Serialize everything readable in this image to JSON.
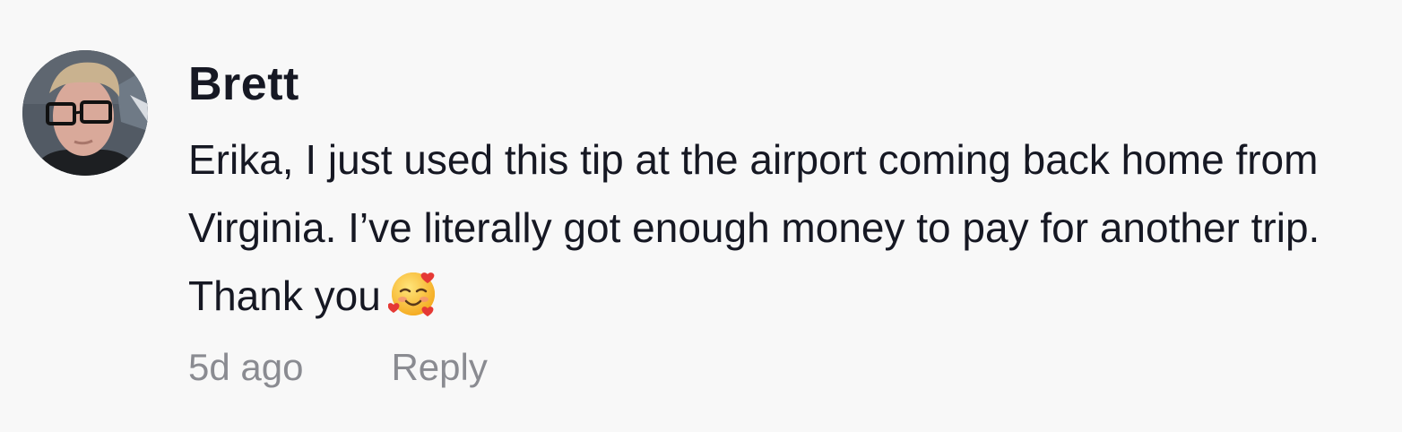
{
  "comment": {
    "username": "Brett",
    "avatar_icon": "user-avatar-photo",
    "text": "Erika, I just used this tip at the airport coming back home from Virginia. I’ve literally got enough money to pay for another trip. Thank you",
    "emoji_icon": "smiling-face-with-hearts-icon",
    "timestamp": "5d ago",
    "reply_label": "Reply"
  },
  "colors": {
    "background": "#f8f8f8",
    "text_primary": "#161823",
    "text_secondary": "#8a8b91"
  }
}
